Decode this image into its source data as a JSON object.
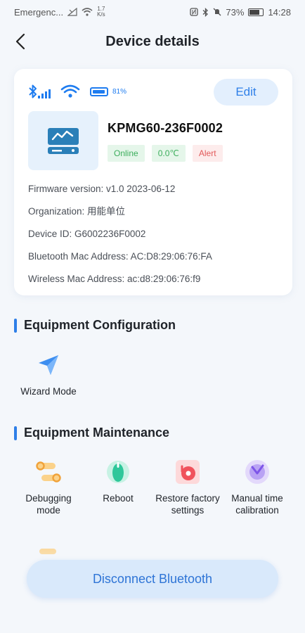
{
  "status_bar": {
    "left_text": "Emergenc...",
    "net_speed_value": "1.7",
    "net_speed_unit": "K/s",
    "battery": "73%",
    "time": "14:28"
  },
  "header": {
    "title": "Device details"
  },
  "device": {
    "battery_level": "81%",
    "edit_label": "Edit",
    "name": "KPMG60-236F0002",
    "badges": [
      {
        "label": "Online",
        "color": "#3cae5c"
      },
      {
        "label": "0.0℃",
        "color": "#3cae5c"
      },
      {
        "label": "Alert",
        "color": "#e25a5a"
      }
    ],
    "info": [
      "Firmware version: v1.0 2023-06-12",
      "Organization: 用能单位",
      "Device ID: G6002236F0002",
      "Bluetooth Mac Address: AC:D8:29:06:76:FA",
      "Wireless Mac Address: ac:d8:29:06:76:f9"
    ]
  },
  "configuration": {
    "title": "Equipment Configuration",
    "items": [
      {
        "label": "Wizard Mode",
        "icon": "navigation-arrow-icon"
      }
    ]
  },
  "maintenance": {
    "title": "Equipment Maintenance",
    "items": [
      {
        "label": "Debugging mode",
        "icon": "debug-toggle-icon"
      },
      {
        "label": "Reboot",
        "icon": "reboot-icon"
      },
      {
        "label": "Restore factory settings",
        "icon": "restore-icon"
      },
      {
        "label": "Manual time calibration",
        "icon": "time-calibration-icon"
      }
    ]
  },
  "footer": {
    "disconnect_label": "Disconnect Bluetooth"
  },
  "colors": {
    "accent": "#2e7fe8",
    "background": "#f4f7fb",
    "online": "#3cae5c",
    "alert": "#e25a5a"
  }
}
